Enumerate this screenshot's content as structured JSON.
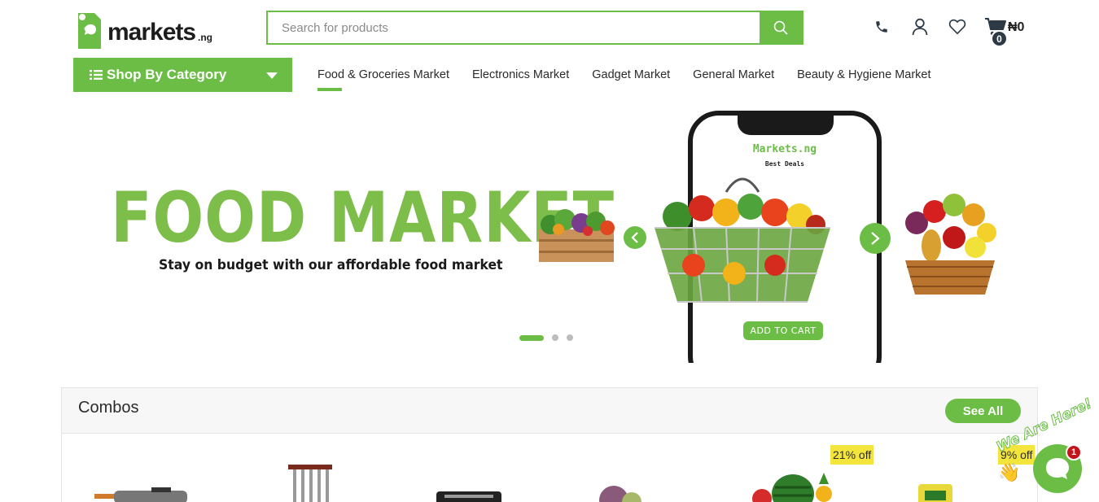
{
  "header": {
    "logo_text": "markets",
    "logo_suffix": ".ng",
    "search_placeholder": "Search for products",
    "cart_count": "0",
    "cart_total": "₦0"
  },
  "nav": {
    "category_label": "Shop By Category",
    "items": [
      {
        "label": "Food & Groceries Market",
        "active": true
      },
      {
        "label": "Electronics Market"
      },
      {
        "label": "Gadget Market"
      },
      {
        "label": "General Market"
      },
      {
        "label": "Beauty & Hygiene Market"
      }
    ]
  },
  "banner": {
    "title": "FOOD MARKET",
    "subtitle": "Stay on budget with our affordable food market",
    "phone_brand": "Markets.ng",
    "phone_tagline": "Best Deals",
    "add_to_cart": "ADD TO CART",
    "slide_count": 3,
    "active_slide": 1
  },
  "combos": {
    "title": "Combos",
    "see_all": "See All",
    "discounts": [
      "21% off",
      "9% off"
    ]
  },
  "chat": {
    "badge": "1",
    "label": "We Are Here!"
  },
  "colors": {
    "brand_green": "#6cbd45",
    "banner_green": "#7dbd4a",
    "badge_dark": "#2d3a46",
    "discount_yellow": "#f3e53b"
  },
  "icons": [
    "logo-bag-icon",
    "search-icon",
    "phone-icon",
    "user-icon",
    "heart-icon",
    "cart-icon",
    "list-icon",
    "chevron-left-icon",
    "chevron-right-icon",
    "chat-icon"
  ]
}
